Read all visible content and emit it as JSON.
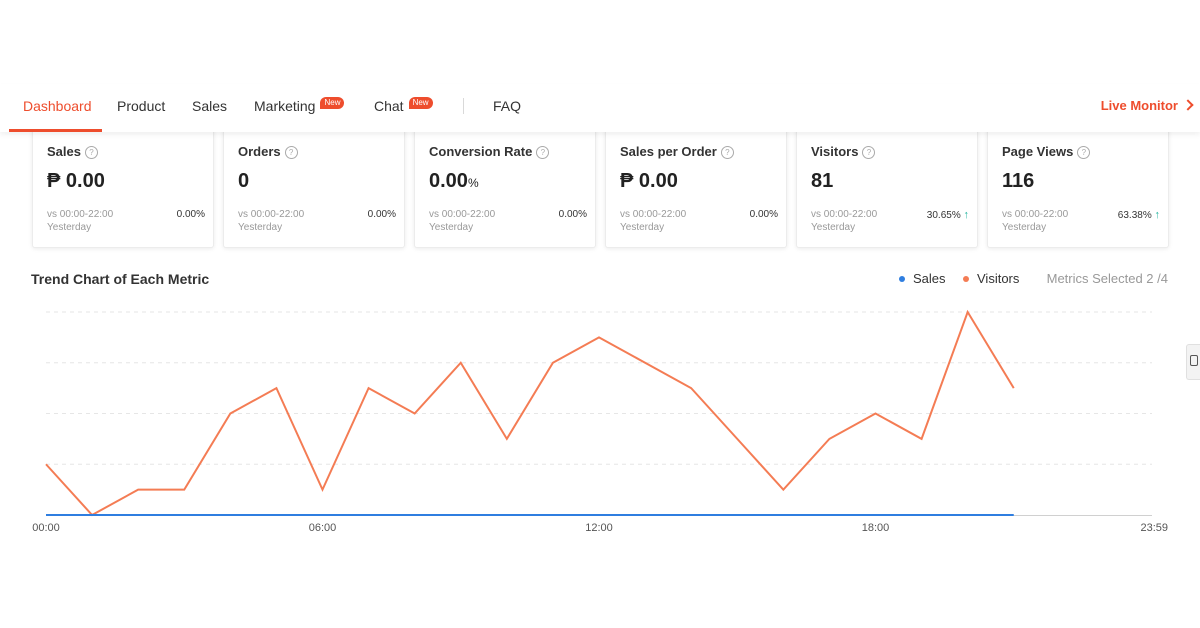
{
  "nav": {
    "tabs": [
      {
        "label": "Dashboard",
        "active": true
      },
      {
        "label": "Product"
      },
      {
        "label": "Sales"
      },
      {
        "label": "Marketing",
        "badge": "New"
      },
      {
        "label": "Chat",
        "badge": "New"
      },
      {
        "label": "FAQ"
      }
    ],
    "live_monitor": "Live Monitor"
  },
  "metrics": [
    {
      "title": "Sales",
      "value": "₱ 0.00",
      "compare": "vs 00:00-22:00",
      "compare_day": "Yesterday",
      "change": "0.00%",
      "trend": ""
    },
    {
      "title": "Orders",
      "value": "0",
      "compare": "vs 00:00-22:00",
      "compare_day": "Yesterday",
      "change": "0.00%",
      "trend": ""
    },
    {
      "title": "Conversion Rate",
      "value": "0.00",
      "value_unit": "%",
      "compare": "vs 00:00-22:00",
      "compare_day": "Yesterday",
      "change": "0.00%",
      "trend": ""
    },
    {
      "title": "Sales per Order",
      "value": "₱ 0.00",
      "compare": "vs 00:00-22:00",
      "compare_day": "Yesterday",
      "change": "0.00%",
      "trend": ""
    },
    {
      "title": "Visitors",
      "value": "81",
      "compare": "vs 00:00-22:00",
      "compare_day": "Yesterday",
      "change": "30.65%",
      "trend": "up"
    },
    {
      "title": "Page Views",
      "value": "116",
      "compare": "vs 00:00-22:00",
      "compare_day": "Yesterday",
      "change": "63.38%",
      "trend": "up"
    }
  ],
  "chart": {
    "title": "Trend Chart of Each Metric",
    "metrics_selected": "Metrics Selected 2 /4"
  },
  "colors": {
    "accent": "#ee4d2d",
    "sales_series": "#2f7ee0",
    "visitors_series": "#f47c54",
    "trend_up": "#26b5a0"
  },
  "chart_data": {
    "type": "line",
    "x": [
      0,
      1,
      2,
      3,
      4,
      5,
      6,
      7,
      8,
      9,
      10,
      11,
      12,
      13,
      14,
      15,
      16,
      17,
      18,
      19,
      20,
      21
    ],
    "xticks": [
      "00:00",
      "06:00",
      "12:00",
      "18:00",
      "23:59"
    ],
    "xlim": [
      0,
      24
    ],
    "ylim": [
      0,
      8
    ],
    "grid": true,
    "legend_position": "top-right",
    "series": [
      {
        "name": "Sales",
        "color": "#2f7ee0",
        "values": [
          0,
          0,
          0,
          0,
          0,
          0,
          0,
          0,
          0,
          0,
          0,
          0,
          0,
          0,
          0,
          0,
          0,
          0,
          0,
          0,
          0,
          0
        ]
      },
      {
        "name": "Visitors",
        "color": "#f47c54",
        "values": [
          2,
          0,
          1,
          1,
          4,
          5,
          1,
          5,
          4,
          6,
          3,
          6,
          7,
          6,
          5,
          3,
          1,
          3,
          4,
          3,
          8,
          5
        ]
      }
    ]
  }
}
